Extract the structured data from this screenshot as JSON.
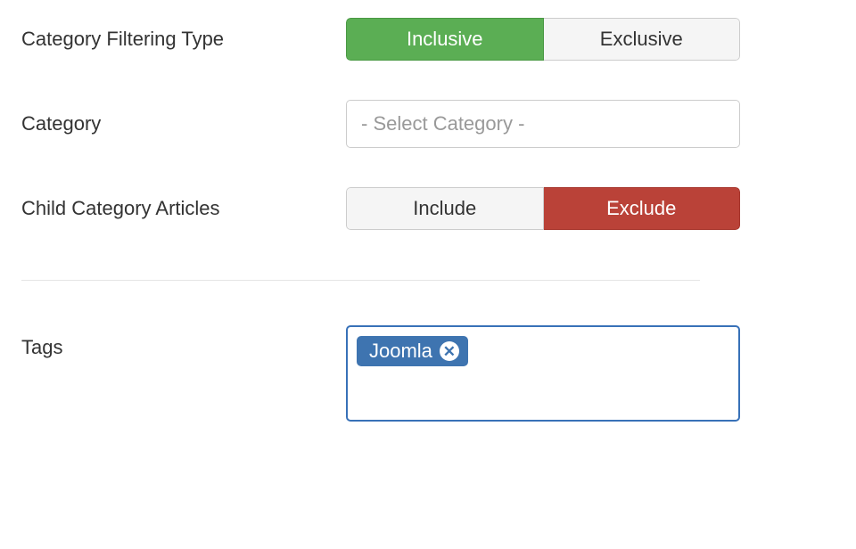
{
  "rows": {
    "categoryFilteringType": {
      "label": "Category Filtering Type",
      "options": [
        "Inclusive",
        "Exclusive"
      ],
      "selectedIndex": 0
    },
    "category": {
      "label": "Category",
      "placeholder": "- Select Category -"
    },
    "childCategoryArticles": {
      "label": "Child Category Articles",
      "options": [
        "Include",
        "Exclude"
      ],
      "selectedIndex": 1
    },
    "tags": {
      "label": "Tags",
      "items": [
        "Joomla"
      ]
    }
  }
}
